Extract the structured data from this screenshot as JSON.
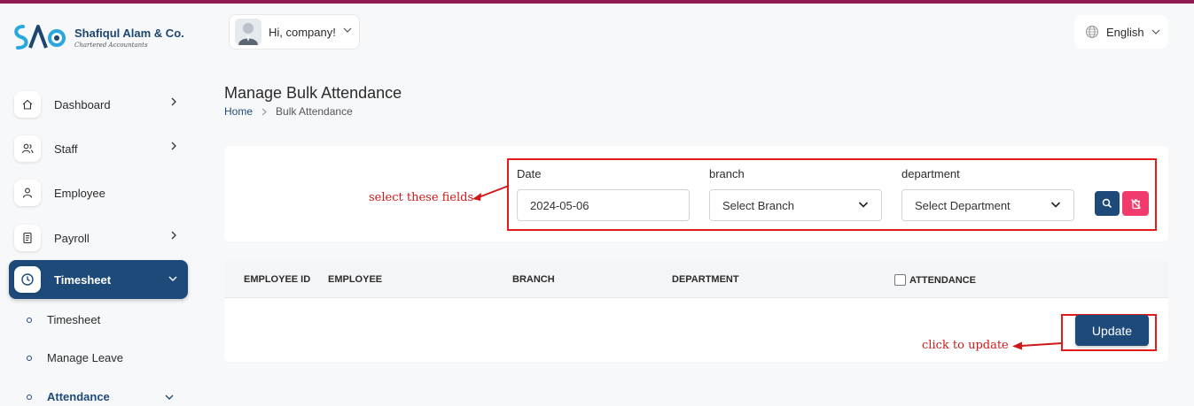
{
  "brand": {
    "name": "Shafiqul Alam & Co.",
    "subtitle": "Chartered Accountants",
    "accent_color": "#1e4a7a",
    "top_stripe_color": "#8e1c52"
  },
  "sidebar": {
    "items": [
      {
        "label": "Dashboard",
        "icon": "home-icon",
        "has_chevron": true
      },
      {
        "label": "Staff",
        "icon": "users-icon",
        "has_chevron": true
      },
      {
        "label": "Employee",
        "icon": "user-icon",
        "has_chevron": false
      },
      {
        "label": "Payroll",
        "icon": "receipt-icon",
        "has_chevron": true
      },
      {
        "label": "Timesheet",
        "icon": "clock-icon",
        "has_chevron": true,
        "active": true
      }
    ],
    "sub_items": [
      {
        "label": "Timesheet"
      },
      {
        "label": "Manage Leave"
      },
      {
        "label": "Attendance",
        "expanded": true
      }
    ]
  },
  "topbar": {
    "greeting": "Hi, company!",
    "language": "English"
  },
  "page": {
    "title": "Manage Bulk Attendance",
    "breadcrumb": {
      "home": "Home",
      "current": "Bulk Attendance"
    }
  },
  "filters": {
    "date": {
      "label": "Date",
      "value": "2024-05-06"
    },
    "branch": {
      "label": "branch",
      "value": "Select Branch"
    },
    "department": {
      "label": "department",
      "value": "Select Department"
    },
    "search_icon": "search-icon",
    "clear_icon": "trash-off-icon"
  },
  "table": {
    "columns": [
      "EMPLOYEE ID",
      "EMPLOYEE",
      "BRANCH",
      "DEPARTMENT",
      "ATTENDANCE"
    ],
    "rows": [],
    "update_label": "Update"
  },
  "annotations": {
    "fields_note": "select these fields",
    "update_note": "click to update",
    "color": "#d01818"
  }
}
